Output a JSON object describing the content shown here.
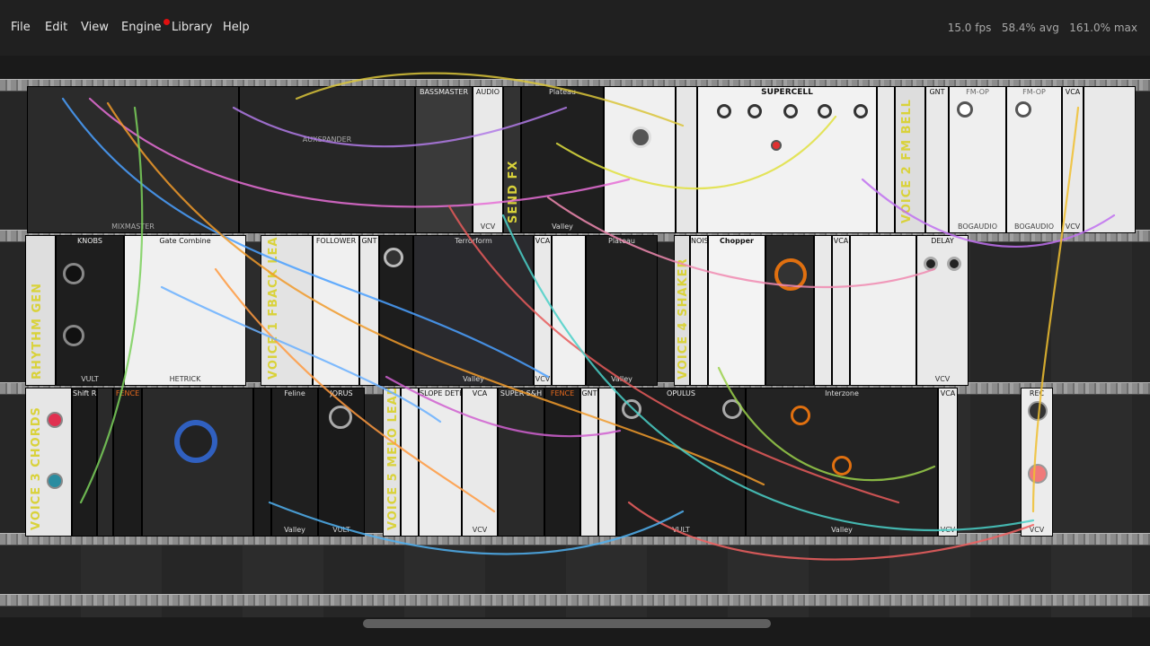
{
  "menu": {
    "file": "File",
    "edit": "Edit",
    "view": "View",
    "engine": "Engine",
    "library": "Library",
    "help": "Help",
    "library_notification_color": "#e01010"
  },
  "stats": {
    "fps": "15.0 fps",
    "avg": "58.4% avg",
    "max": "161.0% max"
  },
  "rows": [
    {
      "label": "SEND FX",
      "modules": [
        {
          "name": "MIXMASTER",
          "brand": "MIXMASTER"
        },
        {
          "name": "AUXSPANDER",
          "brand": "AUXSPANDER"
        },
        {
          "name": "BASSMASTER",
          "brand": ""
        },
        {
          "name": "AUDIO",
          "brand": "VCV"
        },
        {
          "name": "Plateau",
          "brand": "Valley"
        },
        {
          "name": "",
          "brand": ""
        },
        {
          "name": "SUPERCELL",
          "brand": ""
        },
        {
          "name": "GNT",
          "brand": ""
        },
        {
          "name": "FM-OP",
          "brand": "BOGAUDIO"
        },
        {
          "name": "FM-OP",
          "brand": "BOGAUDIO"
        },
        {
          "name": "VCA",
          "brand": "VCV"
        }
      ],
      "second_label": "VOICE 2 FM BELL"
    },
    {
      "label": "RHYTHM GEN",
      "modules": [
        {
          "name": "KNOBS",
          "brand": "VULT"
        },
        {
          "name": "Gate Combine",
          "brand": "HETRICK"
        },
        {
          "name": "FOLLOWER",
          "brand": ""
        },
        {
          "name": "GNT",
          "brand": ""
        },
        {
          "name": "Terrorform",
          "brand": "Valley"
        },
        {
          "name": "VCA",
          "brand": "VCV"
        },
        {
          "name": "Plateau",
          "brand": "Valley"
        },
        {
          "name": "NOIS",
          "brand": ""
        },
        {
          "name": "Chopper",
          "brand": ""
        },
        {
          "name": "VCA",
          "brand": ""
        },
        {
          "name": "DELAY",
          "brand": "VCV"
        }
      ],
      "second_label": "VOICE 1 FBACK LEAD",
      "third_label": "VOICE 4 SHAKER"
    },
    {
      "label": "VOICE 3 CHORDS",
      "modules": [
        {
          "name": "Shift Register",
          "brand": ""
        },
        {
          "name": "FENCE",
          "brand": ""
        },
        {
          "name": "Feline",
          "brand": "Valley"
        },
        {
          "name": "JORUS",
          "brand": "VULT"
        },
        {
          "name": "SLOPE DETECTOR",
          "brand": ""
        },
        {
          "name": "VCA",
          "brand": "VCV"
        },
        {
          "name": "SUPER S&H",
          "brand": ""
        },
        {
          "name": "FENCE",
          "brand": ""
        },
        {
          "name": "GNT",
          "brand": ""
        },
        {
          "name": "OPULUS",
          "brand": "VULT"
        },
        {
          "name": "Interzone",
          "brand": "Valley"
        },
        {
          "name": "VCA",
          "brand": "VCV"
        },
        {
          "name": "REC",
          "brand": "VCV"
        }
      ],
      "second_label": "VOICE 5 MELO LEAD"
    }
  ],
  "colors": {
    "menubar_bg": "#202020",
    "rack_bg": "#1a1a1a",
    "menu_text": "#e6e6e6",
    "stats_text": "#a8a8a8",
    "label_text": "#d9d23a"
  }
}
